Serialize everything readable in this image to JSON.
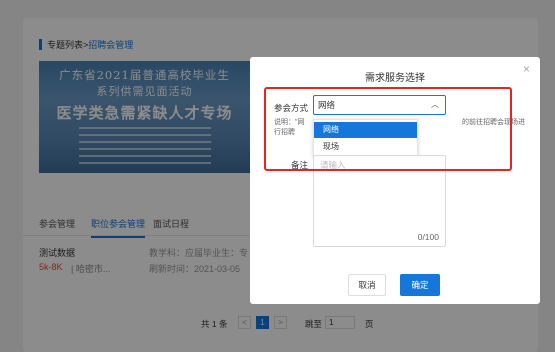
{
  "breadcrumb": {
    "home": "专题列表",
    "separator": ">",
    "current": "招聘会管理"
  },
  "banner": {
    "line1": "广东省2021届普通高校毕业生",
    "line2": "系列供需见面活动",
    "line3": "医学类急需紧缺人才专场"
  },
  "tabs": [
    "参会管理",
    "职位参会管理",
    "面试日程"
  ],
  "job": {
    "name": "测试数据",
    "salary": "5k-8K",
    "city": "| 哈密市...",
    "education": "教学科：应届毕业生：专",
    "refresh": "刷新时间：2021-03-05"
  },
  "pagination": {
    "total": "共 1 条",
    "prev": "<",
    "page": "1",
    "next": ">",
    "goto": "跳至",
    "input_value": "1",
    "page_word": "页"
  },
  "dialog": {
    "title": "需求服务选择",
    "close": "×",
    "method_label": "参会方式",
    "method_value": "网络",
    "caret": "︿",
    "description_label": "说明：",
    "description_start": "\"网",
    "description_tail": "的前往招聘会现场进",
    "description_line2": "行招聘",
    "options": [
      "网络",
      "现场"
    ],
    "note_label": "备注",
    "note_placeholder": "请输入",
    "counter": "0/100",
    "cancel": "取消",
    "confirm": "确定"
  },
  "colors": {
    "primary": "#1677d9",
    "highlight": "#e6251f",
    "salary": "#e84c3d"
  }
}
